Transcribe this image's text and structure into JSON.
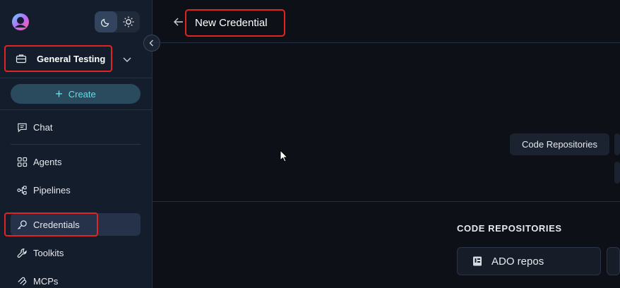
{
  "theme": {
    "dark_icon": "moon-icon",
    "light_icon": "sun-icon",
    "selected": "dark"
  },
  "project": {
    "name": "General Testing"
  },
  "create_label": "Create",
  "nav": {
    "chat": "Chat",
    "agents": "Agents",
    "pipelines": "Pipelines",
    "credentials": "Credentials",
    "toolkits": "Toolkits",
    "mcps": "MCPs"
  },
  "header": {
    "title": "New Credential"
  },
  "categories": [
    "Code Repositories"
  ],
  "section": {
    "title": "CODE REPOSITORIES"
  },
  "cards": [
    {
      "label": "ADO repos",
      "icon": "repo-icon"
    }
  ],
  "colors": {
    "accent": "#5ee0e8",
    "highlight": "#e02424",
    "background": "#0d1117",
    "sidebar": "#141d2b"
  }
}
